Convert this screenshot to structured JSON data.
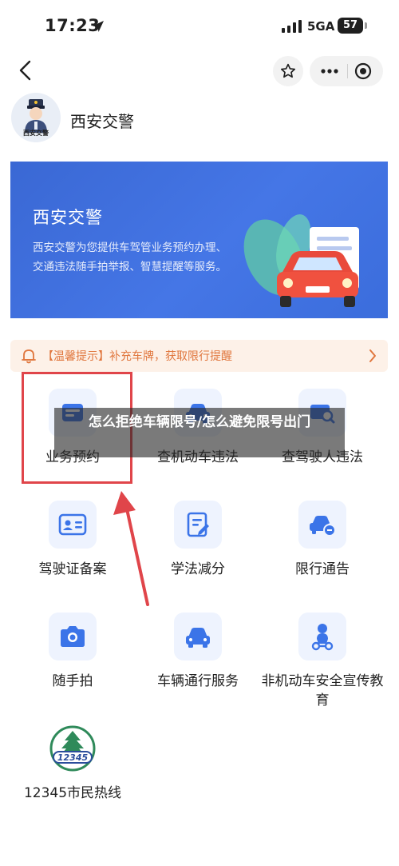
{
  "status_bar": {
    "time": "17:23",
    "network": "5GA",
    "battery": "57"
  },
  "account": {
    "name": "西安交警",
    "avatar_caption": "西安交警"
  },
  "banner": {
    "title": "西安交警",
    "description": "西安交警为您提供车驾管业务预约办理、交通违法随手拍举报、智慧提醒等服务。"
  },
  "notice": {
    "text": "【温馨提示】补充车牌，获取限行提醒"
  },
  "services": [
    {
      "label": "业务预约",
      "icon": "calendar-card-icon"
    },
    {
      "label": "查机动车违法",
      "icon": "car-icon"
    },
    {
      "label": "查驾驶人违法",
      "icon": "license-search-icon"
    },
    {
      "label": "驾驶证备案",
      "icon": "id-card-icon"
    },
    {
      "label": "学法减分",
      "icon": "edit-document-icon"
    },
    {
      "label": "限行通告",
      "icon": "car-restriction-icon"
    },
    {
      "label": "随手拍",
      "icon": "camera-icon"
    },
    {
      "label": "车辆通行服务",
      "icon": "car-icon"
    },
    {
      "label": "非机动车安全宣传教育",
      "icon": "scooter-rider-icon"
    },
    {
      "label": "12345市民热线",
      "icon": "hotline-logo-icon"
    }
  ],
  "hotline_logo_text": "12345",
  "overlay": {
    "text": "怎么拒绝车辆限号/怎么避免限号出门"
  },
  "colors": {
    "accent": "#3a68d4",
    "notice": "#e0763d",
    "annotation": "#e0454a",
    "icon_blue": "#3b74e8"
  }
}
